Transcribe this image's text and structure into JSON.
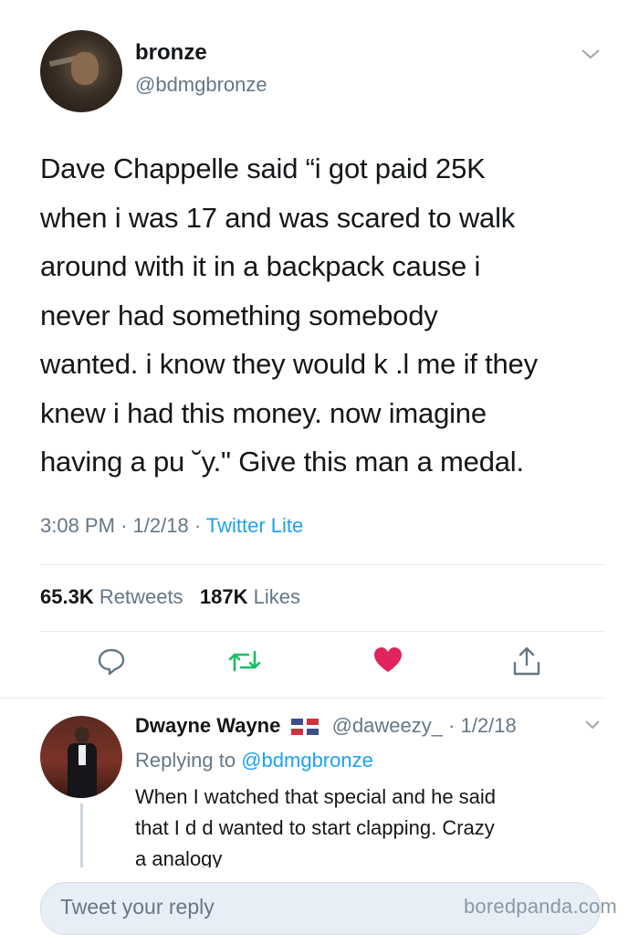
{
  "tweet": {
    "author_name": "bronze",
    "author_handle": "@bdmgbronze",
    "text": "Dave Chappelle said “i got paid 25K\nwhen i was 17 and was scared to walk\naround with it in a backpack cause i\nnever had something somebody\nwanted. i know they would k .l me if they\nknew i had this money. now imagine\nhaving a pu  ˘y.\" Give this man a medal.",
    "time": "3:08 PM",
    "date": "1/2/18",
    "separator": "·",
    "source": "Twitter Lite",
    "retweets_count": "65.3K",
    "retweets_label": "Retweets",
    "likes_count": "187K",
    "likes_label": "Likes"
  },
  "actions": {
    "reply_icon": "reply-icon",
    "retweet_icon": "retweet-icon",
    "like_icon": "heart-icon",
    "share_icon": "share-icon"
  },
  "reply": {
    "author_name": "Dwayne Wayne",
    "author_handle": "@daweezy_",
    "separator": "·",
    "date": "1/2/18",
    "replying_prefix": "Replying to",
    "replying_handle": "@bdmgbronze",
    "text": "When I watched that special and he said\nthat I d      d wanted to start clapping. Crazy\na       analogy"
  },
  "compose": {
    "placeholder": "Tweet your reply"
  },
  "watermark": "boredpanda.com",
  "colors": {
    "link": "#1da1f2",
    "secondary_text": "#657786",
    "retweet_active": "#17bf63",
    "like_active": "#e0245e",
    "divider": "#e6ecf0"
  }
}
